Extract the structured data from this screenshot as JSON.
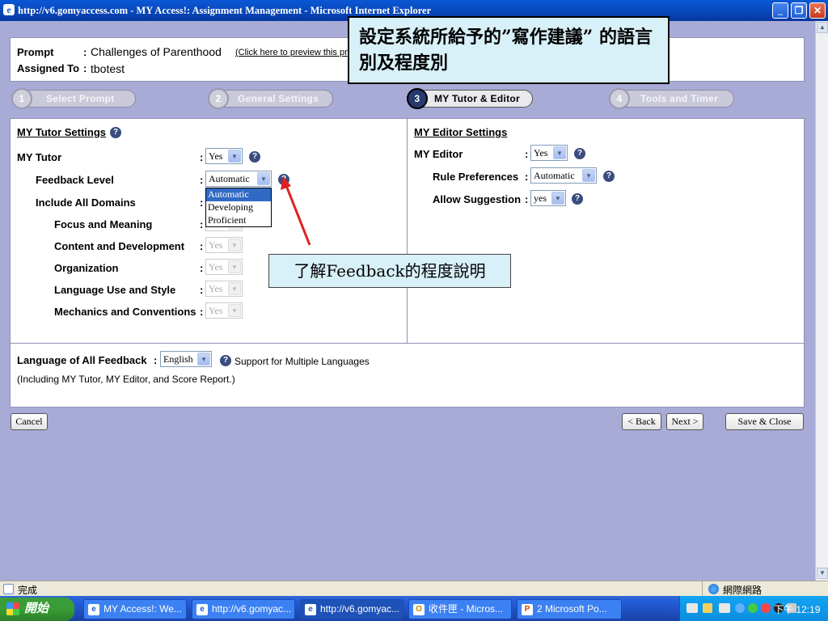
{
  "window": {
    "title": "http://v6.gomyaccess.com - MY Access!: Assignment Management - Microsoft Internet Explorer",
    "minimize_icon": "minimize-icon",
    "maximize_icon": "restore-icon",
    "close_icon": "close-icon"
  },
  "header": {
    "prompt_label": "Prompt",
    "prompt_value": "Challenges of Parenthood",
    "preview_link": "(Click here to preview this pr",
    "assigned_label": "Assigned To",
    "assigned_value": "tbotest",
    "colon": ":"
  },
  "steps": [
    {
      "number": "1",
      "label": "Select Prompt"
    },
    {
      "number": "2",
      "label": "General Settings"
    },
    {
      "number": "3",
      "label": "MY Tutor & Editor"
    },
    {
      "number": "4",
      "label": "Tools and Timer"
    }
  ],
  "tutor": {
    "heading": "MY Tutor Settings",
    "rows": [
      {
        "label": "MY Tutor",
        "value": "Yes"
      },
      {
        "label": "Feedback Level",
        "value": "Automatic"
      },
      {
        "label": "Include All Domains",
        "value": ""
      },
      {
        "label": "Focus and Meaning",
        "value": ""
      },
      {
        "label": "Content and Development",
        "value": "Yes"
      },
      {
        "label": "Organization",
        "value": "Yes"
      },
      {
        "label": "Language Use and Style",
        "value": "Yes"
      },
      {
        "label": "Mechanics and Conventions",
        "value": "Yes"
      }
    ],
    "feedback_options": [
      "Automatic",
      "Developing",
      "Proficient"
    ]
  },
  "editor": {
    "heading": "MY Editor Settings",
    "rows": [
      {
        "label": "MY Editor",
        "value": "Yes"
      },
      {
        "label": "Rule Preferences",
        "value": "Automatic"
      },
      {
        "label": "Allow Suggestion",
        "value": "yes"
      }
    ]
  },
  "language": {
    "label": "Language of All Feedback",
    "value": "English",
    "support_text": "Support for Multiple Languages",
    "note": "(Including MY Tutor, MY Editor, and Score Report.)"
  },
  "buttons": {
    "cancel": "Cancel",
    "back": "< Back",
    "next": "Next >",
    "save_close": "Save & Close"
  },
  "callouts": {
    "top": "設定系統所給予的”寫作建議” 的語言別及程度別",
    "middle": "了解Feedback的程度說明"
  },
  "status": {
    "text": "完成",
    "zone": "網際網路"
  },
  "taskbar": {
    "start": "開始",
    "tasks": [
      "MY Access!: We...",
      "http://v6.gomyac...",
      "http://v6.gomyac...",
      "收件匣 - Micros...",
      "2 Microsoft Po..."
    ],
    "clock": "下午 12:19"
  },
  "colors": {
    "page_bg": "#a8abd6",
    "panel_bg": "#ffffff",
    "callout_bg": "#d8f0f8",
    "arrow": "#e02020",
    "highlight": "#316ac5"
  }
}
